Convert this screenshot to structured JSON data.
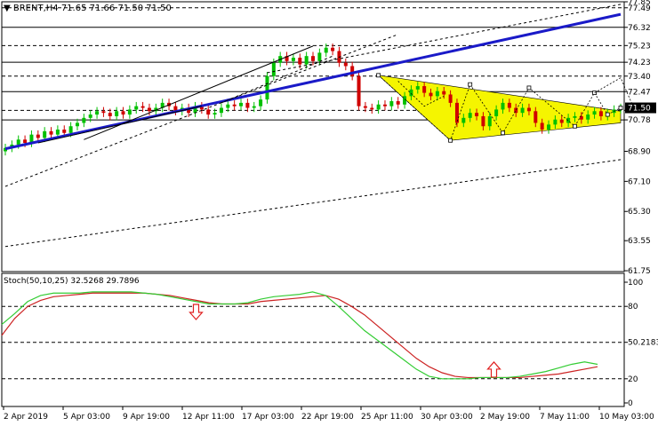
{
  "chart_data": {
    "type": "line",
    "instrument": "BRENT",
    "header": "▼ BRENT,H4  71.65 71.66 71.50 71.50",
    "colors": {
      "bull": "#00c000",
      "bear": "#d00000",
      "trend": "#1a1ac8",
      "triangle": "#f5f500",
      "stoch_main": "#33cc33",
      "stoch_signal": "#cc2222",
      "grid": "#000000",
      "price_tag": "#000000"
    },
    "main": {
      "ylim": [
        61.7,
        77.85
      ],
      "y_ticks": [
        77.85,
        77.49,
        76.32,
        75.23,
        74.23,
        73.4,
        72.47,
        71.35,
        70.78,
        68.9,
        67.1,
        65.3,
        63.55,
        61.75
      ],
      "y_tick_labels": [
        "77.85",
        "77.49",
        "76.32",
        "75.23",
        "74.23",
        "73.40",
        "72.47",
        "71.35",
        "70.78",
        "68.90",
        "67.10",
        "65.30",
        "63.55",
        "61.75"
      ],
      "hlines": [
        77.49,
        76.32,
        75.23,
        74.23,
        73.4,
        72.47,
        71.35,
        70.78
      ],
      "current_price": 71.5,
      "current_price_label": "71.50",
      "close_series": [
        69.1,
        69.3,
        69.6,
        69.4,
        69.9,
        69.7,
        70.1,
        69.9,
        70.2,
        70.0,
        70.4,
        70.6,
        70.9,
        71.1,
        71.3,
        71.2,
        71.0,
        71.3,
        71.1,
        71.4,
        71.6,
        71.5,
        71.3,
        71.5,
        71.8,
        71.6,
        71.3,
        71.5,
        71.2,
        71.6,
        71.4,
        71.1,
        71.2,
        71.5,
        71.7,
        71.6,
        71.8,
        71.5,
        71.6,
        72.0,
        73.4,
        74.2,
        74.6,
        74.3,
        74.5,
        74.1,
        74.6,
        74.3,
        74.8,
        75.1,
        74.9,
        74.2,
        74.0,
        73.4,
        71.6,
        71.5,
        71.4,
        71.7,
        71.6,
        71.9,
        71.7,
        72.2,
        72.6,
        72.8,
        72.4,
        72.2,
        72.5,
        72.3,
        71.8,
        70.6,
        70.9,
        71.2,
        71.0,
        70.4,
        71.0,
        71.4,
        71.8,
        71.5,
        71.2,
        71.5,
        71.3,
        70.6,
        70.2,
        70.5,
        70.8,
        70.6,
        70.9,
        71.0,
        70.8,
        71.1,
        71.3,
        71.0,
        71.2,
        71.4,
        71.5
      ],
      "trend_lines": [
        {
          "p1": [
            0,
            69.05
          ],
          "p2": [
            94,
            77.1
          ],
          "color": "#1a1ac8",
          "style": "solid",
          "width": 3
        },
        {
          "p1": [
            0,
            66.8
          ],
          "p2": [
            60,
            75.9
          ],
          "color": "#000000",
          "style": "dash",
          "width": 1
        },
        {
          "p1": [
            0,
            63.2
          ],
          "p2": [
            94,
            68.4
          ],
          "color": "#000000",
          "style": "dash",
          "width": 1
        },
        {
          "p1": [
            40,
            73.6
          ],
          "p2": [
            94,
            77.7
          ],
          "color": "#000000",
          "style": "dash",
          "width": 1
        },
        {
          "p1": [
            12,
            69.6
          ],
          "p2": [
            47,
            75.2
          ],
          "color": "#000000",
          "style": "solid",
          "width": 1
        },
        {
          "p1": [
            5,
            69.4
          ],
          "p2": [
            30,
            71.6
          ],
          "color": "#000000",
          "style": "solid",
          "width": 1
        },
        {
          "p1": [
            33,
            71.8
          ],
          "p2": [
            50,
            74.6
          ],
          "color": "#000000",
          "style": "dash",
          "width": 1
        }
      ],
      "triangle": [
        [
          57,
          73.45
        ],
        [
          68,
          69.55
        ],
        [
          94,
          71.0
        ]
      ],
      "triangle_band": [
        [
          57,
          73.45
        ],
        [
          94,
          71.3
        ],
        [
          94,
          70.6
        ],
        [
          68,
          69.55
        ]
      ],
      "wave_points": [
        [
          57,
          73.45
        ],
        [
          68,
          69.55
        ],
        [
          71,
          72.9
        ],
        [
          76,
          70.0
        ],
        [
          80,
          72.7
        ],
        [
          87,
          70.4
        ],
        [
          90,
          72.4
        ],
        [
          92,
          71.1
        ],
        [
          94,
          71.5
        ]
      ],
      "zigzag": [
        [
          60,
          73.1
        ],
        [
          64,
          71.6
        ],
        [
          67,
          72.2
        ]
      ],
      "projection": [
        [
          90,
          72.4
        ],
        [
          94,
          73.3
        ],
        [
          96,
          71.5
        ]
      ]
    },
    "stoch": {
      "label": "Stoch(50,10,25) 32.5268 29.7896",
      "ylim": [
        0,
        100
      ],
      "y_ticks": [
        100,
        80,
        50.2183,
        20,
        0
      ],
      "y_tick_labels": [
        "100",
        "80",
        "50.2183",
        "20",
        "0"
      ],
      "hlines": [
        80,
        50.2183,
        20
      ],
      "main": [
        65,
        74,
        84,
        89,
        91,
        91,
        91,
        92,
        92,
        92,
        92,
        91,
        90,
        88,
        86,
        84,
        82,
        82,
        82,
        83,
        86,
        88,
        89,
        90,
        92,
        89,
        80,
        70,
        60,
        52,
        44,
        36,
        28,
        22,
        20,
        20,
        20,
        21,
        21,
        21,
        22,
        24,
        26,
        29,
        32,
        34,
        32
      ],
      "signal": [
        56,
        70,
        80,
        85,
        88,
        89,
        90,
        91,
        91,
        91,
        91,
        91,
        90,
        89,
        87,
        85,
        83,
        82,
        82,
        82,
        84,
        85,
        86,
        87,
        88,
        89,
        86,
        80,
        73,
        64,
        55,
        46,
        37,
        30,
        25,
        22,
        21,
        21,
        21,
        21,
        21,
        22,
        23,
        24,
        26,
        28,
        30
      ],
      "arrows": [
        {
          "index": 15,
          "value": 75,
          "dir": "down"
        },
        {
          "index": 38,
          "value": 28,
          "dir": "up"
        }
      ]
    },
    "x_labels": [
      "2 Apr 2019",
      "5 Apr 03:00",
      "9 Apr 19:00",
      "12 Apr 11:00",
      "17 Apr 03:00",
      "22 Apr 19:00",
      "25 Apr 11:00",
      "30 Apr 03:00",
      "2 May 19:00",
      "7 May 11:00",
      "10 May 03:00"
    ]
  }
}
